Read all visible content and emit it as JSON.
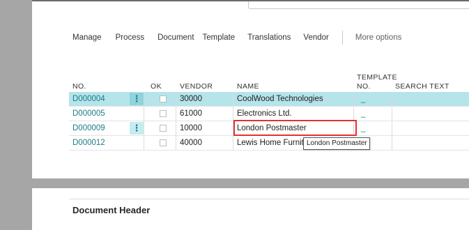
{
  "actions": [
    "Manage",
    "Process",
    "Document",
    "Template",
    "Translations",
    "Vendor"
  ],
  "more_options": "More options",
  "columns": {
    "no": "NO.",
    "ok": "OK",
    "vendor": "VENDOR",
    "name": "NAME",
    "template_line1": "TEMPLATE",
    "template_line2": "NO.",
    "search_text": "SEARCH TEXT"
  },
  "rows": [
    {
      "no": "D000004",
      "vendor": "30000",
      "name": "CoolWood Technologies",
      "search": "_"
    },
    {
      "no": "D000005",
      "vendor": "61000",
      "name": "Electronics Ltd.",
      "search": "_"
    },
    {
      "no": "D000009",
      "vendor": "10000",
      "name": "London Postmaster",
      "search": "_"
    },
    {
      "no": "D000012",
      "vendor": "40000",
      "name": "Lewis Home Furniture",
      "search": "_"
    }
  ],
  "row_menu_glyph": "⋮",
  "tooltip": "London Postmaster",
  "section": {
    "title": "Document Header"
  },
  "colors": {
    "selected_row": "#b5e4ea",
    "link": "#1b7c87",
    "focus_border": "#e03232"
  }
}
